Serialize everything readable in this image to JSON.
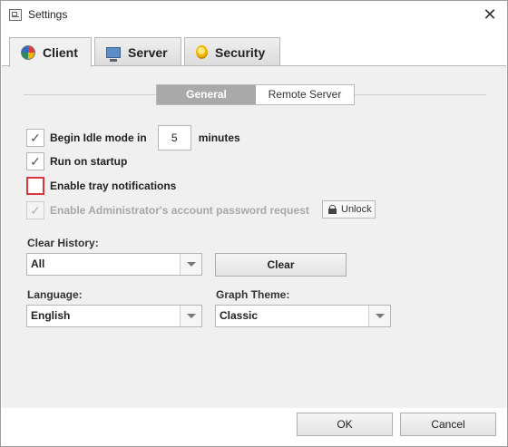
{
  "window": {
    "title": "Settings",
    "close_glyph": "✕"
  },
  "tabs": [
    {
      "label": "Client",
      "icon": "client-icon"
    },
    {
      "label": "Server",
      "icon": "monitor-icon"
    },
    {
      "label": "Security",
      "icon": "shield-icon"
    }
  ],
  "segments": {
    "general": "General",
    "remote_server": "Remote Server"
  },
  "options": {
    "idle_label": "Begin Idle mode in",
    "idle_value": "5",
    "idle_unit": "minutes",
    "run_on_startup": "Run on startup",
    "tray_notifications": "Enable tray notifications",
    "admin_password": "Enable Administrator's account password request",
    "unlock_label": "Unlock",
    "check_glyph": "✓"
  },
  "clear_history": {
    "label": "Clear History:",
    "selected": "All",
    "button": "Clear"
  },
  "language": {
    "label": "Language:",
    "selected": "English"
  },
  "graph_theme": {
    "label": "Graph Theme:",
    "selected": "Classic"
  },
  "footer": {
    "ok": "OK",
    "cancel": "Cancel"
  },
  "colors": {
    "accent_red": "#d9363e",
    "segment_active": "#a9a9a9",
    "panel_bg": "#f0f0f0"
  }
}
